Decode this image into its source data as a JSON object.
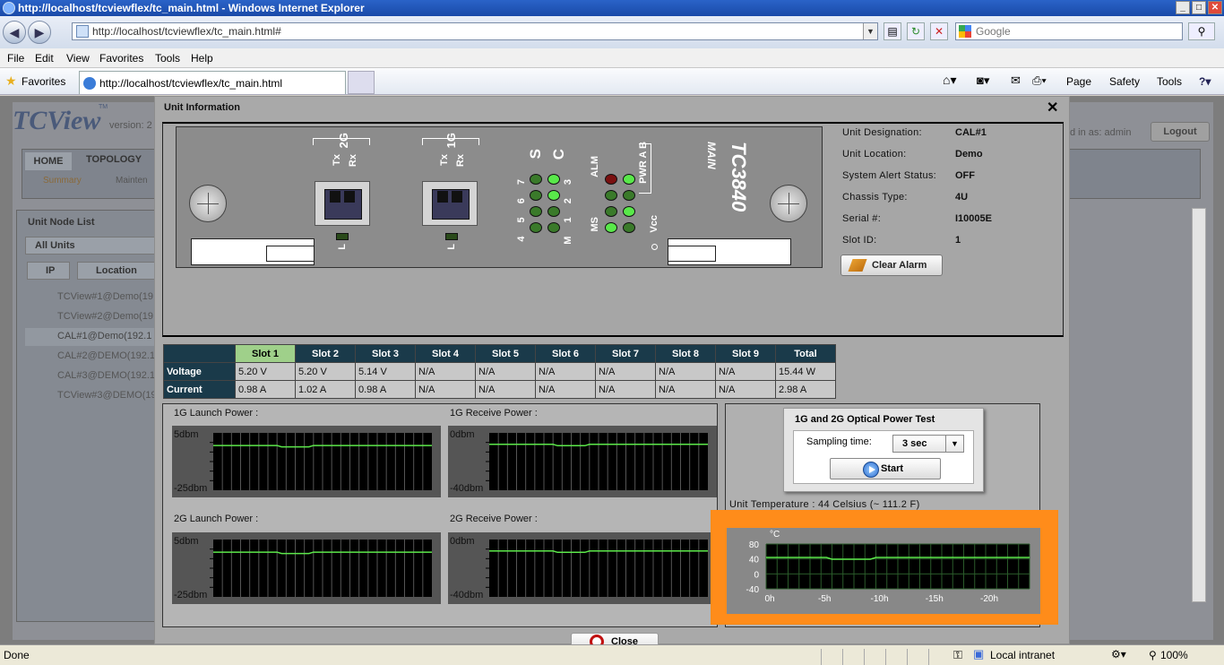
{
  "browser": {
    "title": "http://localhost/tcviewflex/tc_main.html - Windows Internet Explorer",
    "address": "http://localhost/tcviewflex/tc_main.html#",
    "search_placeholder": "Google",
    "menu": [
      "File",
      "Edit",
      "View",
      "Favorites",
      "Tools",
      "Help"
    ],
    "favorites_label": "Favorites",
    "tab_title": "http://localhost/tcviewflex/tc_main.html",
    "commands": [
      "Page",
      "Safety",
      "Tools"
    ],
    "status_left": "Done",
    "status_zone": "Local intranet",
    "zoom": "100%"
  },
  "background_app": {
    "logo": "TCView",
    "logo_tm": "TM",
    "version_label": "version: 2",
    "logged_in_as": "d in as: admin",
    "logout_label": "Logout",
    "nav_tabs": [
      "HOME",
      "TOPOLOGY"
    ],
    "sub_tabs": [
      "Summary",
      "Mainten"
    ],
    "panel_title": "Unit Node List",
    "filter_value": "All Units",
    "view_buttons": [
      "IP",
      "Location"
    ],
    "nodes": [
      "TCView#1@Demo(19",
      "TCView#2@Demo(19",
      "CAL#1@Demo(192.1",
      "CAL#2@DEMO(192.1",
      "CAL#3@DEMO(192.1",
      "TCView#3@DEMO(19"
    ]
  },
  "modal": {
    "title": "Unit Information",
    "close_glyph": "✕",
    "card": {
      "model": "TC3840",
      "sub": "MAIN",
      "port_2g_label": "2G",
      "port_1g_label": "1G",
      "tx": "Tx",
      "rx": "Rx",
      "link": "L",
      "s_label": "S",
      "c_label": "C",
      "s_nums": "4 5 6 7",
      "c_nums": "M 1 2 3",
      "pwr": "PWR A B",
      "alm": "ALM",
      "ms": "MS",
      "vcc": "Vcc"
    },
    "unit_info": [
      {
        "label": "Unit Designation:",
        "value": "CAL#1"
      },
      {
        "label": "Unit Location:",
        "value": "Demo"
      },
      {
        "label": "System Alert Status:",
        "value": "OFF"
      },
      {
        "label": "Chassis Type:",
        "value": "4U"
      },
      {
        "label": "Serial #:",
        "value": "I10005E"
      },
      {
        "label": "Slot ID:",
        "value": "1"
      }
    ],
    "clear_alarm_label": "Clear Alarm",
    "power_table": {
      "headers": [
        "Slot 1",
        "Slot 2",
        "Slot 3",
        "Slot 4",
        "Slot 5",
        "Slot 6",
        "Slot 7",
        "Slot 8",
        "Slot 9",
        "Total"
      ],
      "rows": [
        {
          "label": "Voltage",
          "cells": [
            "5.20 V",
            "5.20 V",
            "5.14 V",
            "N/A",
            "N/A",
            "N/A",
            "N/A",
            "N/A",
            "N/A",
            "15.44 W"
          ]
        },
        {
          "label": "Current",
          "cells": [
            "0.98 A",
            "1.02 A",
            "0.98 A",
            "N/A",
            "N/A",
            "N/A",
            "N/A",
            "N/A",
            "N/A",
            "2.98 A"
          ]
        }
      ]
    },
    "charts": [
      {
        "title": "1G Launch Power :",
        "ymax": "5dbm",
        "ymin": "-25dbm",
        "level": 0.22
      },
      {
        "title": "1G Receive Power :",
        "ymax": "0dbm",
        "ymin": "-40dbm",
        "level": 0.2
      },
      {
        "title": "2G Launch Power :",
        "ymax": "5dbm",
        "ymin": "-25dbm",
        "level": 0.22
      },
      {
        "title": "2G Receive Power :",
        "ymax": "0dbm",
        "ymin": "-40dbm",
        "level": 0.2
      }
    ],
    "optical_test": {
      "title": "1G and 2G Optical Power Test",
      "sampling_label": "Sampling time:",
      "sampling_value": "3 sec",
      "start_label": "Start"
    },
    "temperature": {
      "label": "Unit Temperature : 44 Celsius (~ 111.2 F)",
      "unit": "°C",
      "yticks": [
        "80",
        "40",
        "0",
        "-40"
      ],
      "xticks": [
        "0h",
        "-5h",
        "-10h",
        "-15h",
        "-20h"
      ],
      "level_c": 44
    },
    "close_label": "Close"
  }
}
